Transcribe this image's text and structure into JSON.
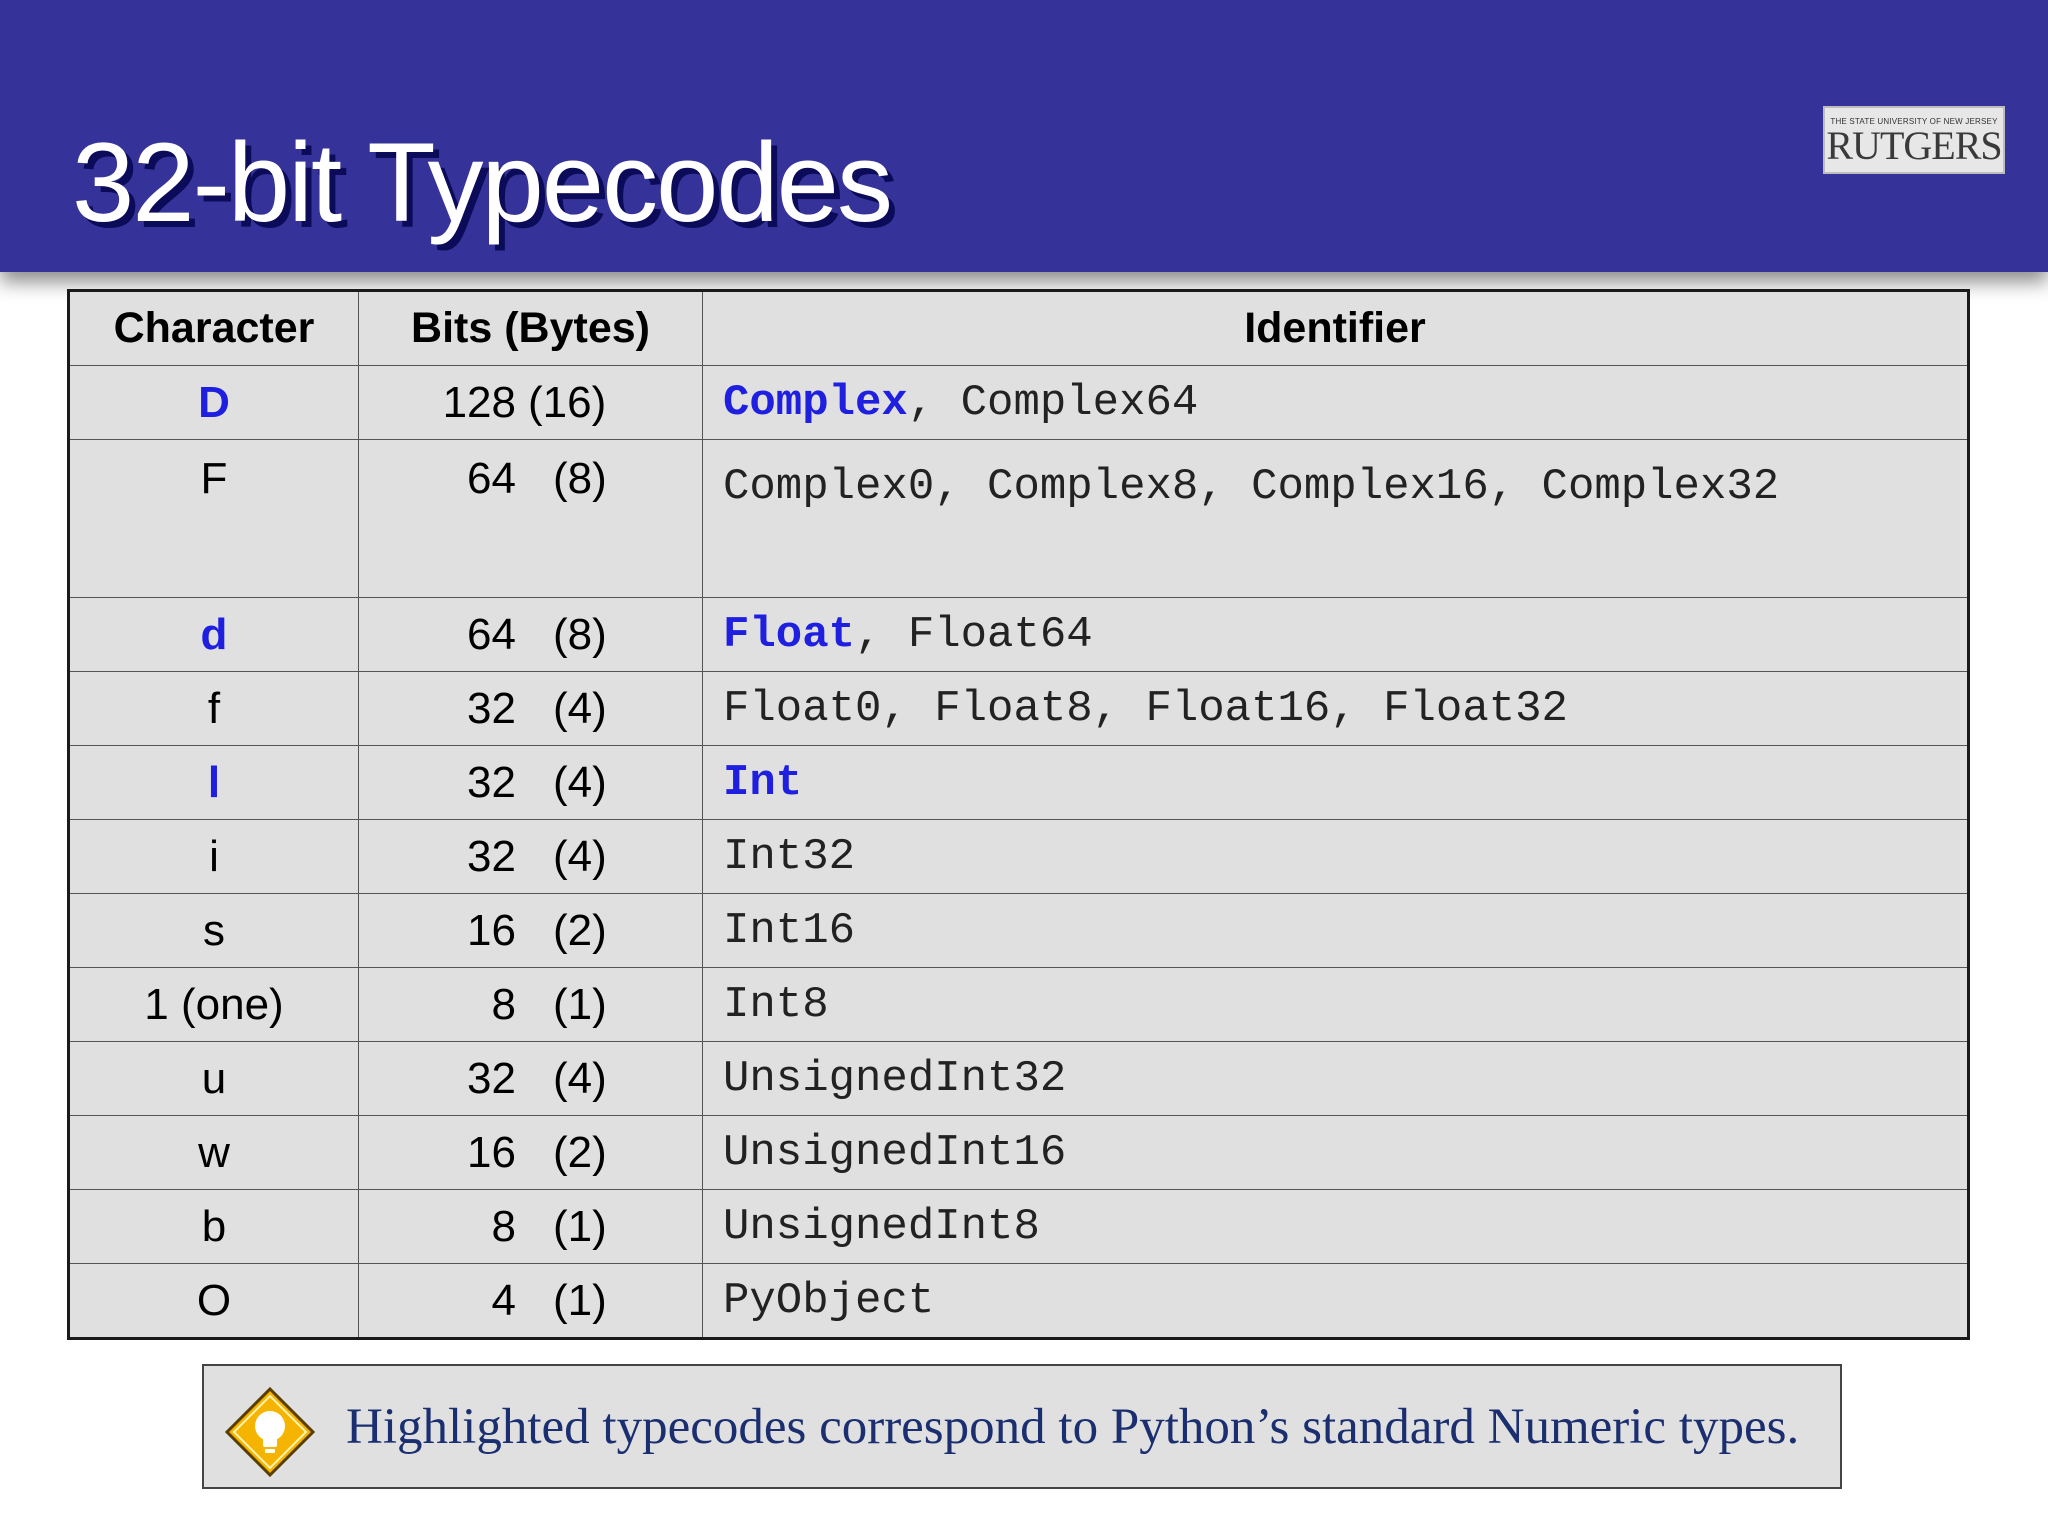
{
  "slide": {
    "title": "32-bit Typecodes",
    "logo": {
      "tagline": "THE STATE UNIVERSITY OF NEW JERSEY",
      "brand": "RUTGERS"
    }
  },
  "table": {
    "headers": {
      "character": "Character",
      "bits": "Bits (Bytes)",
      "identifier": "Identifier"
    },
    "rows": [
      {
        "character": "D",
        "bits": "128",
        "bytes": "(16)",
        "highlight": true,
        "id_main": "Complex",
        "id_rest": ", Complex64"
      },
      {
        "character": "F",
        "bits": "64",
        "bytes": "(8)",
        "highlight": false,
        "id_main": "",
        "id_rest": "Complex0, Complex8, Complex16, Complex32"
      },
      {
        "character": "d",
        "bits": "64",
        "bytes": "(8)",
        "highlight": true,
        "id_main": "Float",
        "id_rest": ", Float64"
      },
      {
        "character": "f",
        "bits": "32",
        "bytes": "(4)",
        "highlight": false,
        "id_main": "",
        "id_rest": "Float0, Float8, Float16, Float32"
      },
      {
        "character": "l",
        "bits": "32",
        "bytes": "(4)",
        "highlight": true,
        "id_main": "Int",
        "id_rest": ""
      },
      {
        "character": "i",
        "bits": "32",
        "bytes": "(4)",
        "highlight": false,
        "id_main": "",
        "id_rest": "Int32"
      },
      {
        "character": "s",
        "bits": "16",
        "bytes": "(2)",
        "highlight": false,
        "id_main": "",
        "id_rest": "Int16"
      },
      {
        "character": "1 (one)",
        "bits": "8",
        "bytes": "(1)",
        "highlight": false,
        "id_main": "",
        "id_rest": "Int8"
      },
      {
        "character": "u",
        "bits": "32",
        "bytes": "(4)",
        "highlight": false,
        "id_main": "",
        "id_rest": "UnsignedInt32"
      },
      {
        "character": "w",
        "bits": "16",
        "bytes": "(2)",
        "highlight": false,
        "id_main": "",
        "id_rest": "UnsignedInt16"
      },
      {
        "character": "b",
        "bits": "8",
        "bytes": "(1)",
        "highlight": false,
        "id_main": "",
        "id_rest": "UnsignedInt8"
      },
      {
        "character": "O",
        "bits": "4",
        "bytes": "(1)",
        "highlight": false,
        "id_main": "",
        "id_rest": "PyObject"
      }
    ]
  },
  "note": {
    "icon": "lightbulb-icon",
    "text": "Highlighted typecodes correspond to Python’s standard Numeric types."
  },
  "colors": {
    "header_bg": "#353399",
    "highlight": "#1f1fe0",
    "note_text": "#1a2e70",
    "table_bg": "#e0e0e0"
  }
}
